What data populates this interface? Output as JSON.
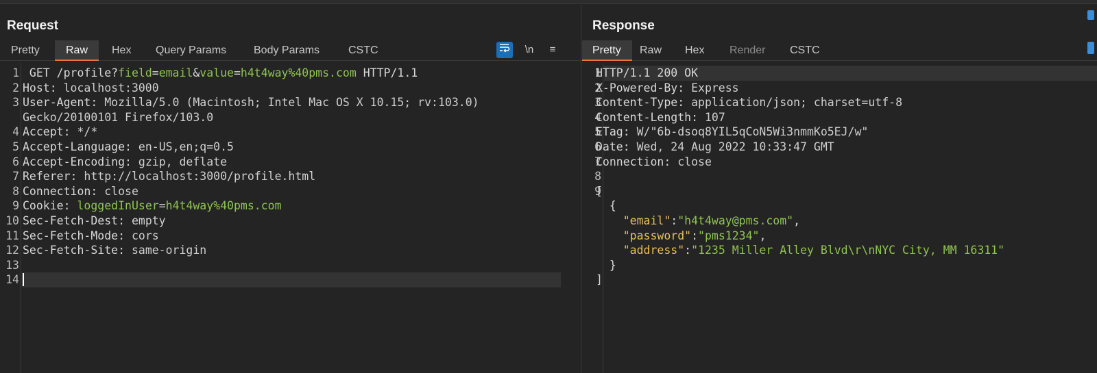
{
  "request": {
    "title": "Request",
    "tabs": [
      "Pretty",
      "Raw",
      "Hex",
      "Query Params",
      "Body Params",
      "CSTC"
    ],
    "active_tab": "Raw",
    "tools": {
      "wrap": "wrap-lines-icon",
      "newline": "\\n",
      "menu": "≡"
    },
    "lines": [
      {
        "n": "1",
        "parts": [
          [
            "k",
            " GET /profile?"
          ],
          [
            "g",
            "field"
          ],
          [
            "k",
            "="
          ],
          [
            "g",
            "email"
          ],
          [
            "k",
            "&"
          ],
          [
            "g",
            "value"
          ],
          [
            "k",
            "="
          ],
          [
            "g",
            "h4t4way%40pms.com"
          ],
          [
            "k",
            " HTTP/1.1"
          ]
        ]
      },
      {
        "n": "2",
        "parts": [
          [
            "k",
            "Host:"
          ],
          [
            "v",
            " localhost:3000"
          ]
        ]
      },
      {
        "n": "3",
        "parts": [
          [
            "k",
            "User-Agent:"
          ],
          [
            "v",
            " Mozilla/5.0 (Macintosh; Intel Mac OS X 10.15; rv:103.0)"
          ]
        ]
      },
      {
        "n": "",
        "parts": [
          [
            "v",
            "Gecko/20100101 Firefox/103.0"
          ]
        ]
      },
      {
        "n": "4",
        "parts": [
          [
            "k",
            "Accept:"
          ],
          [
            "v",
            " */*"
          ]
        ]
      },
      {
        "n": "5",
        "parts": [
          [
            "k",
            "Accept-Language:"
          ],
          [
            "v",
            " en-US,en;q=0.5"
          ]
        ]
      },
      {
        "n": "6",
        "parts": [
          [
            "k",
            "Accept-Encoding:"
          ],
          [
            "v",
            " gzip, deflate"
          ]
        ]
      },
      {
        "n": "7",
        "parts": [
          [
            "k",
            "Referer:"
          ],
          [
            "v",
            " http://localhost:3000/profile.html"
          ]
        ]
      },
      {
        "n": "8",
        "parts": [
          [
            "k",
            "Connection:"
          ],
          [
            "v",
            " close"
          ]
        ]
      },
      {
        "n": "9",
        "parts": [
          [
            "k",
            "Cookie:"
          ],
          [
            "v",
            " "
          ],
          [
            "g",
            "loggedInUser"
          ],
          [
            "v",
            "="
          ],
          [
            "g",
            "h4t4way%40pms.com"
          ]
        ]
      },
      {
        "n": "10",
        "parts": [
          [
            "k",
            "Sec-Fetch-Dest:"
          ],
          [
            "v",
            " empty"
          ]
        ]
      },
      {
        "n": "11",
        "parts": [
          [
            "k",
            "Sec-Fetch-Mode:"
          ],
          [
            "v",
            " cors"
          ]
        ]
      },
      {
        "n": "12",
        "parts": [
          [
            "k",
            "Sec-Fetch-Site:"
          ],
          [
            "v",
            " same-origin"
          ]
        ]
      },
      {
        "n": "13",
        "parts": []
      },
      {
        "n": "14",
        "parts": []
      }
    ]
  },
  "response": {
    "title": "Response",
    "tabs": [
      "Pretty",
      "Raw",
      "Hex",
      "Render",
      "CSTC"
    ],
    "active_tab": "Pretty",
    "lines": [
      {
        "n": "1",
        "parts": [
          [
            "k",
            "HTTP/1.1 200 OK"
          ]
        ]
      },
      {
        "n": "2",
        "parts": [
          [
            "k",
            "X-Powered-By:"
          ],
          [
            "v",
            " Express"
          ]
        ]
      },
      {
        "n": "3",
        "parts": [
          [
            "k",
            "Content-Type:"
          ],
          [
            "v",
            " application/json; charset=utf-8"
          ]
        ]
      },
      {
        "n": "4",
        "parts": [
          [
            "k",
            "Content-Length:"
          ],
          [
            "v",
            " 107"
          ]
        ]
      },
      {
        "n": "5",
        "parts": [
          [
            "k",
            "ETag:"
          ],
          [
            "v",
            " W/\"6b-dsoq8YIL5qCoN5Wi3nmmKo5EJ/w\""
          ]
        ]
      },
      {
        "n": "6",
        "parts": [
          [
            "k",
            "Date:"
          ],
          [
            "v",
            " Wed, 24 Aug 2022 10:33:47 GMT"
          ]
        ]
      },
      {
        "n": "7",
        "parts": [
          [
            "k",
            "Connection:"
          ],
          [
            "v",
            " close"
          ]
        ]
      },
      {
        "n": "8",
        "parts": []
      },
      {
        "n": "9",
        "parts": [
          [
            "k",
            "["
          ]
        ]
      },
      {
        "n": "",
        "parts": [
          [
            "k",
            "  {"
          ]
        ]
      },
      {
        "n": "",
        "parts": [
          [
            "k",
            "    "
          ],
          [
            "y",
            "\"email\""
          ],
          [
            "k",
            ":"
          ],
          [
            "g",
            "\"h4t4way@pms.com\""
          ],
          [
            "k",
            ","
          ]
        ]
      },
      {
        "n": "",
        "parts": [
          [
            "k",
            "    "
          ],
          [
            "y",
            "\"password\""
          ],
          [
            "k",
            ":"
          ],
          [
            "g",
            "\"pms1234\""
          ],
          [
            "k",
            ","
          ]
        ]
      },
      {
        "n": "",
        "parts": [
          [
            "k",
            "    "
          ],
          [
            "y",
            "\"address\""
          ],
          [
            "k",
            ":"
          ],
          [
            "g",
            "\"1235 Miller Alley Blvd\\r\\nNYC City, MM 16311\""
          ]
        ]
      },
      {
        "n": "",
        "parts": [
          [
            "k",
            "  }"
          ]
        ]
      },
      {
        "n": "",
        "parts": [
          [
            "k",
            "]"
          ]
        ]
      }
    ]
  },
  "colors": {
    "accent_tab": "#e8763a",
    "string_green": "#8fc44f",
    "json_key": "#e8c05a",
    "wrap_button": "#1b6fb5"
  }
}
